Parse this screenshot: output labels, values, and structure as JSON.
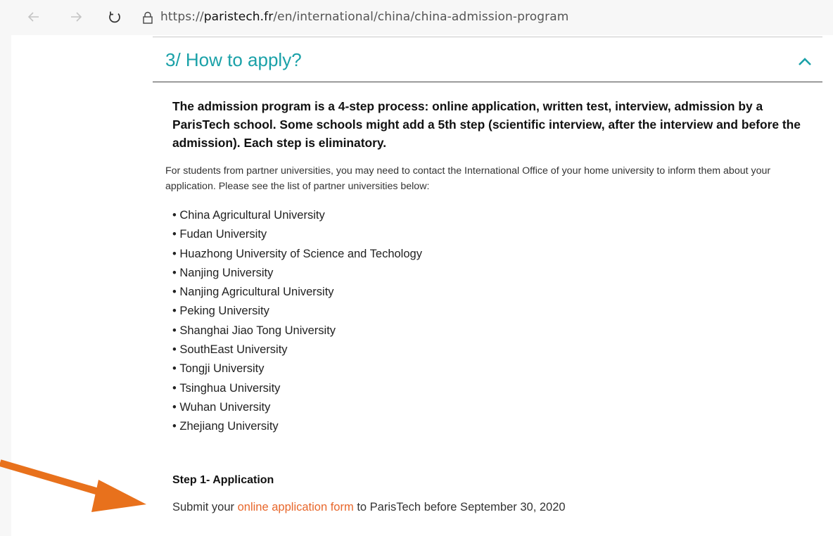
{
  "browser": {
    "url_prefix": "https://",
    "url_domain": "paristech.fr",
    "url_path": "/en/international/china/china-admission-program"
  },
  "section": {
    "title": "3/ How to apply?",
    "lead": "The admission program is a 4-step process: online application, written test, interview, admission by a ParisTech school. Some schools might add a 5th step (scientific interview, after the interview and before the admission). Each step is eliminatory.",
    "intro": "For students from partner universities, you may need to contact the International Office of your home university to inform them about your application. Please see the list of partner universities below:",
    "universities": [
      "China Agricultural University",
      "Fudan University",
      "Huazhong University of Science and Techology",
      "Nanjing University",
      "Nanjing Agricultural University",
      "Peking University",
      "Shanghai Jiao Tong University",
      "SouthEast University",
      "Tongji University",
      "Tsinghua University",
      "Wuhan University",
      "Zhejiang University"
    ]
  },
  "step1": {
    "title": "Step 1- Application",
    "text_before": "Submit your ",
    "link": "online application form",
    "text_after": " to ParisTech before September 30, 2020"
  },
  "colors": {
    "title": "#1aa1a8",
    "link": "#e8672b",
    "arrow": "#e8711c"
  },
  "icons": [
    "back-arrow-icon",
    "forward-arrow-icon",
    "refresh-icon",
    "lock-icon",
    "chevron-up-icon",
    "annotation-arrow-icon"
  ]
}
